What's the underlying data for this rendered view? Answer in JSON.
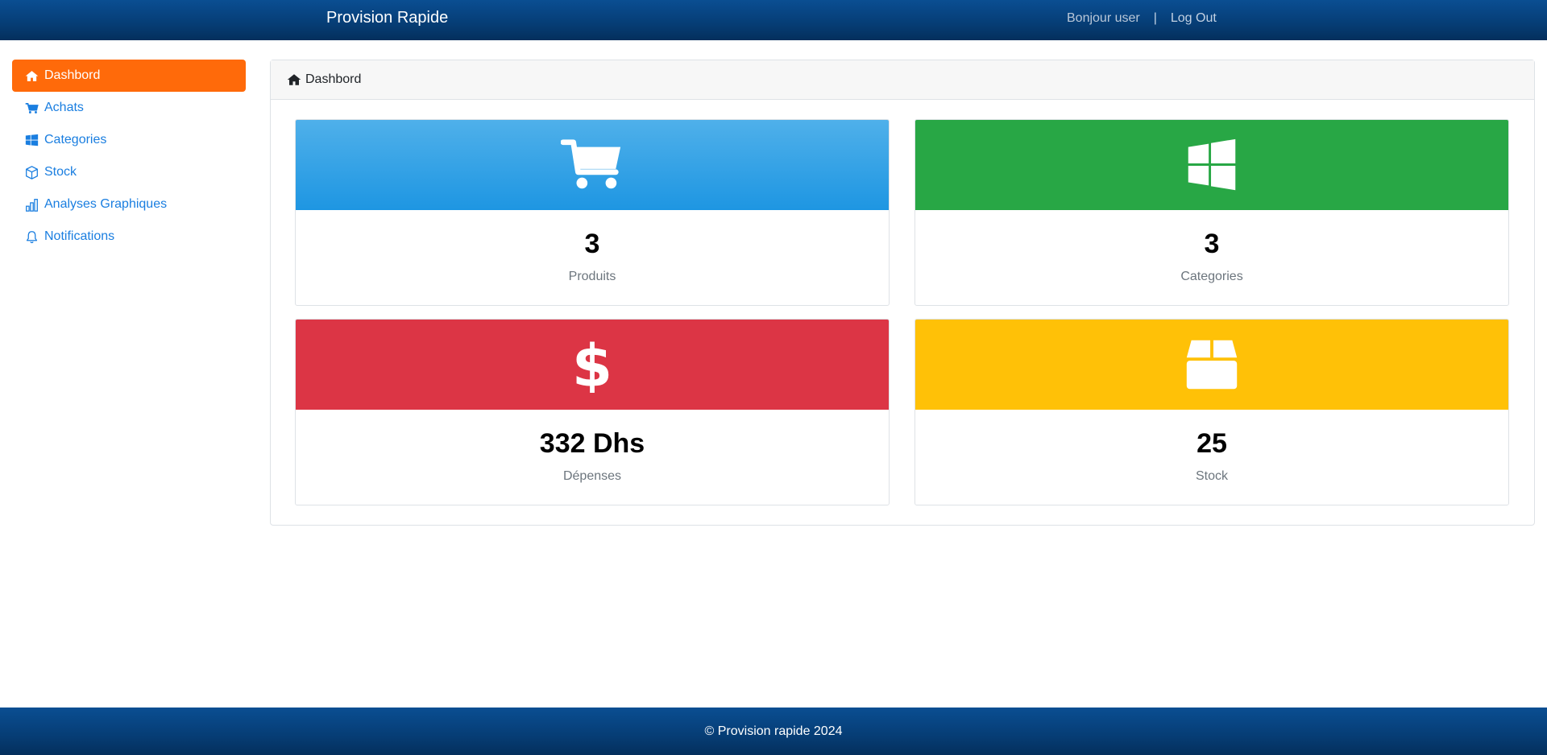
{
  "navbar": {
    "brand": "Provision Rapide",
    "greeting": "Bonjour user",
    "separator": "|",
    "logout": "Log Out"
  },
  "sidebar": {
    "items": [
      {
        "label": "Dashbord",
        "icon": "home-icon",
        "active": true
      },
      {
        "label": "Achats",
        "icon": "cart-icon"
      },
      {
        "label": "Categories",
        "icon": "windows-icon"
      },
      {
        "label": "Stock",
        "icon": "box-icon"
      },
      {
        "label": "Analyses Graphiques",
        "icon": "bar-chart-icon"
      },
      {
        "label": "Notifications",
        "icon": "bell-icon"
      }
    ]
  },
  "panel": {
    "title": "Dashbord",
    "cards": [
      {
        "value": "3",
        "label": "Produits",
        "icon": "cart-icon",
        "color": "#2196e3"
      },
      {
        "value": "3",
        "label": "Categories",
        "icon": "windows-icon",
        "color": "#28a745"
      },
      {
        "value": "332 Dhs",
        "label": "Dépenses",
        "icon": "dollar-icon",
        "color": "#dc3545"
      },
      {
        "value": "25",
        "label": "Stock",
        "icon": "box-icon",
        "color": "#ffc107"
      }
    ]
  },
  "footer": {
    "text": "© Provision rapide 2024"
  },
  "colors": {
    "navbar": "#063d75",
    "active_item": "#ff6a0a",
    "link": "#1a7ee0"
  }
}
